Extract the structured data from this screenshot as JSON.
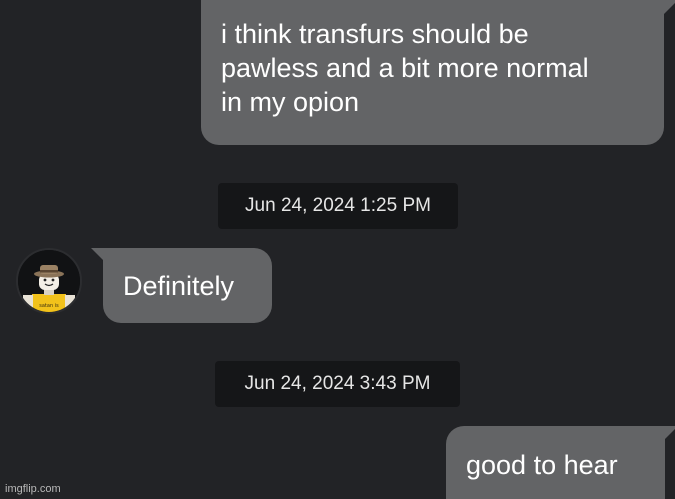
{
  "messages": [
    {
      "direction": "outgoing",
      "lines": [
        "i think transfurs should be",
        "pawless and a bit more normal",
        "in my opion"
      ]
    },
    {
      "direction": "incoming",
      "lines": [
        "Definitely"
      ]
    },
    {
      "direction": "outgoing",
      "lines": [
        "good to hear"
      ]
    }
  ],
  "timestamps": [
    "Jun 24, 2024 1:25 PM",
    "Jun 24, 2024 3:43 PM"
  ],
  "avatar": {
    "icon": "roblox-avatar-with-hat-icon",
    "shirt_text": "satan is"
  },
  "watermark": "imgflip.com",
  "colors": {
    "background": "#222326",
    "bubble": "#636466",
    "timestamp_bg": "#151618",
    "text": "#ffffff"
  }
}
